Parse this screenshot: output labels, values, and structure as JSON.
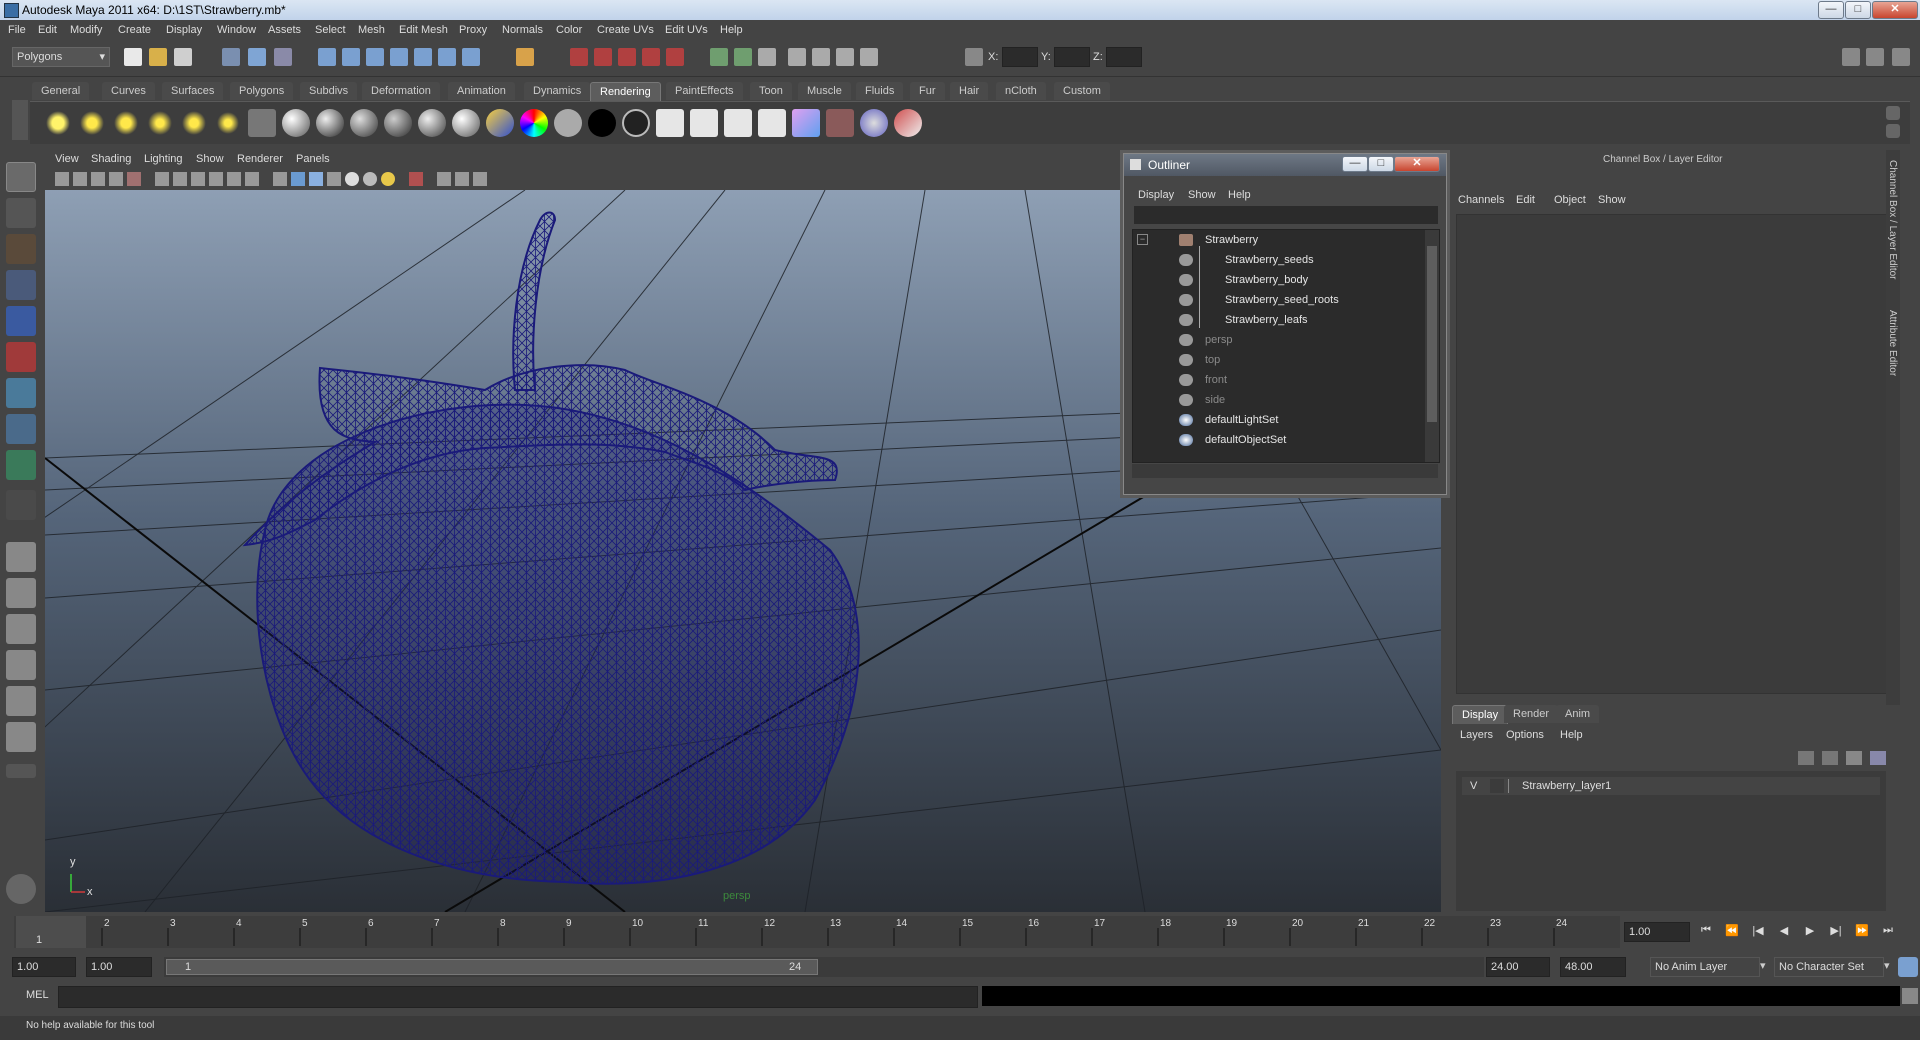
{
  "window": {
    "title": "Autodesk Maya 2011 x64: D:\\1ST\\Strawberry.mb*",
    "minimize": "—",
    "maximize": "□",
    "close": "✕"
  },
  "menubar": [
    "File",
    "Edit",
    "Modify",
    "Create",
    "Display",
    "Window",
    "Assets",
    "Select",
    "Mesh",
    "Edit Mesh",
    "Proxy",
    "Normals",
    "Color",
    "Create UVs",
    "Edit UVs",
    "Help"
  ],
  "statusline": {
    "mode": "Polygons",
    "x_label": "X:",
    "y_label": "Y:",
    "z_label": "Z:"
  },
  "shelf": {
    "tabs": [
      "General",
      "Curves",
      "Surfaces",
      "Polygons",
      "Subdivs",
      "Deformation",
      "Animation",
      "Dynamics",
      "Rendering",
      "PaintEffects",
      "Toon",
      "Muscle",
      "Fluids",
      "Fur",
      "Hair",
      "nCloth",
      "Custom"
    ],
    "active_tab": "Rendering"
  },
  "viewport": {
    "menu": [
      "View",
      "Shading",
      "Lighting",
      "Show",
      "Renderer",
      "Panels"
    ],
    "camera_label": "persp",
    "axis_y": "y",
    "axis_x": "x",
    "wire_color": "#1a1a7a"
  },
  "outliner": {
    "title": "Outliner",
    "menu": [
      "Display",
      "Show",
      "Help"
    ],
    "items": [
      {
        "label": "Strawberry",
        "dim": false
      },
      {
        "label": "Strawberry_seeds",
        "dim": false
      },
      {
        "label": "Strawberry_body",
        "dim": false
      },
      {
        "label": "Strawberry_seed_roots",
        "dim": false
      },
      {
        "label": "Strawberry_leafs",
        "dim": false
      },
      {
        "label": "persp",
        "dim": true
      },
      {
        "label": "top",
        "dim": true
      },
      {
        "label": "front",
        "dim": true
      },
      {
        "label": "side",
        "dim": true
      },
      {
        "label": "defaultLightSet",
        "dim": false
      },
      {
        "label": "defaultObjectSet",
        "dim": false
      }
    ]
  },
  "channelbox": {
    "title": "Channel Box / Layer Editor",
    "menu": [
      "Channels",
      "Edit",
      "Object",
      "Show"
    ],
    "side_tab_1": "Channel Box / Layer Editor",
    "side_tab_2": "Attribute Editor"
  },
  "layer_editor": {
    "tabs": [
      "Display",
      "Render",
      "Anim"
    ],
    "active_tab": "Display",
    "menu": [
      "Layers",
      "Options",
      "Help"
    ],
    "layer_visible": "V",
    "layer_name": "Strawberry_layer1"
  },
  "timeslider": {
    "ticks": [
      "1",
      "2",
      "3",
      "4",
      "5",
      "6",
      "7",
      "8",
      "9",
      "10",
      "11",
      "12",
      "13",
      "14",
      "15",
      "16",
      "17",
      "18",
      "19",
      "20",
      "21",
      "22",
      "23",
      "24"
    ],
    "current_frame_marker": "1",
    "current_time": "1.00",
    "playback_buttons": [
      "⏮",
      "⏪",
      "|◀",
      "◀",
      "▶",
      "▶|",
      "⏩",
      "⏭"
    ]
  },
  "rangeslider": {
    "start": "1.00",
    "playback_start": "1.00",
    "range_start": "1",
    "range_end": "24",
    "playback_end": "24.00",
    "end": "48.00",
    "anim_layer": "No Anim Layer",
    "character_set": "No Character Set"
  },
  "cmdline": {
    "label": "MEL"
  },
  "helpline": {
    "text": "No help available for this tool"
  }
}
